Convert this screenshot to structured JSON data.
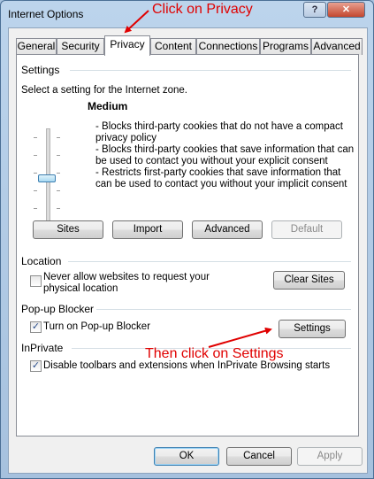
{
  "window": {
    "title": "Internet Options",
    "help_label": "?",
    "close_label": "✕"
  },
  "tabs": [
    {
      "label": "General"
    },
    {
      "label": "Security"
    },
    {
      "label": "Privacy",
      "active": true
    },
    {
      "label": "Content"
    },
    {
      "label": "Connections"
    },
    {
      "label": "Programs"
    },
    {
      "label": "Advanced"
    }
  ],
  "settings": {
    "heading": "Settings",
    "instruction": "Select a setting for the Internet zone.",
    "level": "Medium",
    "slider_position": 0.5,
    "description": [
      "- Blocks third-party cookies that do not have a compact",
      "privacy policy",
      "- Blocks third-party cookies that save information that can",
      "be used to contact you without your explicit consent",
      "- Restricts first-party cookies that save information that",
      "can be used to contact you without your implicit consent"
    ],
    "buttons": {
      "sites": "Sites",
      "import": "Import",
      "advanced": "Advanced",
      "default": "Default"
    }
  },
  "location": {
    "heading": "Location",
    "checkbox_label_1": "Never allow websites to request your",
    "checkbox_label_2": "physical location",
    "checked": false,
    "clear_sites": "Clear Sites"
  },
  "popup": {
    "heading": "Pop-up Blocker",
    "checkbox_label": "Turn on Pop-up Blocker",
    "checked": true,
    "settings_button": "Settings"
  },
  "inprivate": {
    "heading": "InPrivate",
    "checkbox_label": "Disable toolbars and extensions when InPrivate Browsing starts",
    "checked": true
  },
  "footer": {
    "ok": "OK",
    "cancel": "Cancel",
    "apply": "Apply"
  },
  "annotations": {
    "privacy": "Click on Privacy",
    "settings": "Then click on Settings",
    "color": "#e00000"
  },
  "check_mark": "✓"
}
